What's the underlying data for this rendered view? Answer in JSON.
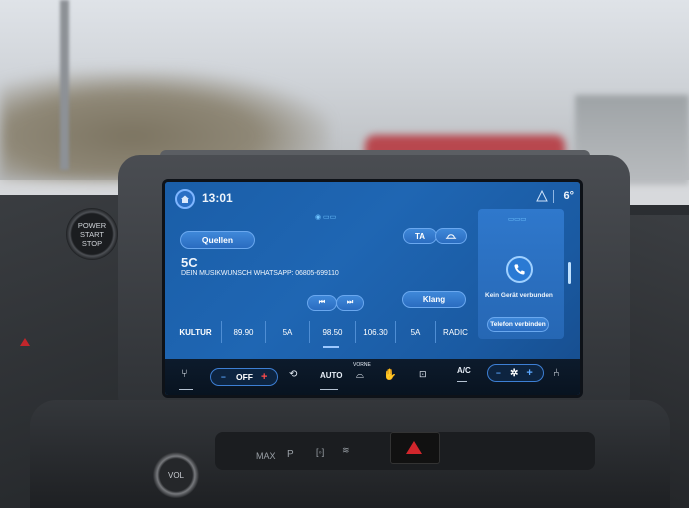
{
  "physical": {
    "power_line1": "POWER",
    "power_line2": "START",
    "power_line3": "STOP",
    "vol_label": "VOL",
    "max_label": "MAX",
    "park_label": "P"
  },
  "status_bar": {
    "time": "13:01",
    "temperature": "6°"
  },
  "radio": {
    "sources_button": "Quellen",
    "ta_button": "TA",
    "station_name": "5C",
    "radio_text": "DEIN MUSIKWUNSCH WHATSAPP: 06805-699110",
    "prev_button": "⏮",
    "next_button": "⏭",
    "sound_button": "Klang",
    "presets": [
      "KULTUR",
      "89.90",
      "5A",
      "98.50",
      "106.30",
      "5A",
      "RADIC"
    ]
  },
  "phone": {
    "status_text": "Kein Gerät verbunden",
    "connect_button": "Telefon verbinden"
  },
  "climate": {
    "fan_off_label": "OFF",
    "minus": "−",
    "plus": "+",
    "auto_label": "AUTO",
    "front_label": "VORNE",
    "ac_label": "A/C"
  },
  "colors": {
    "screen_blue": "#1f66b3",
    "accent_light_blue": "#6ec3ff",
    "hazard_red": "#d2262c"
  }
}
